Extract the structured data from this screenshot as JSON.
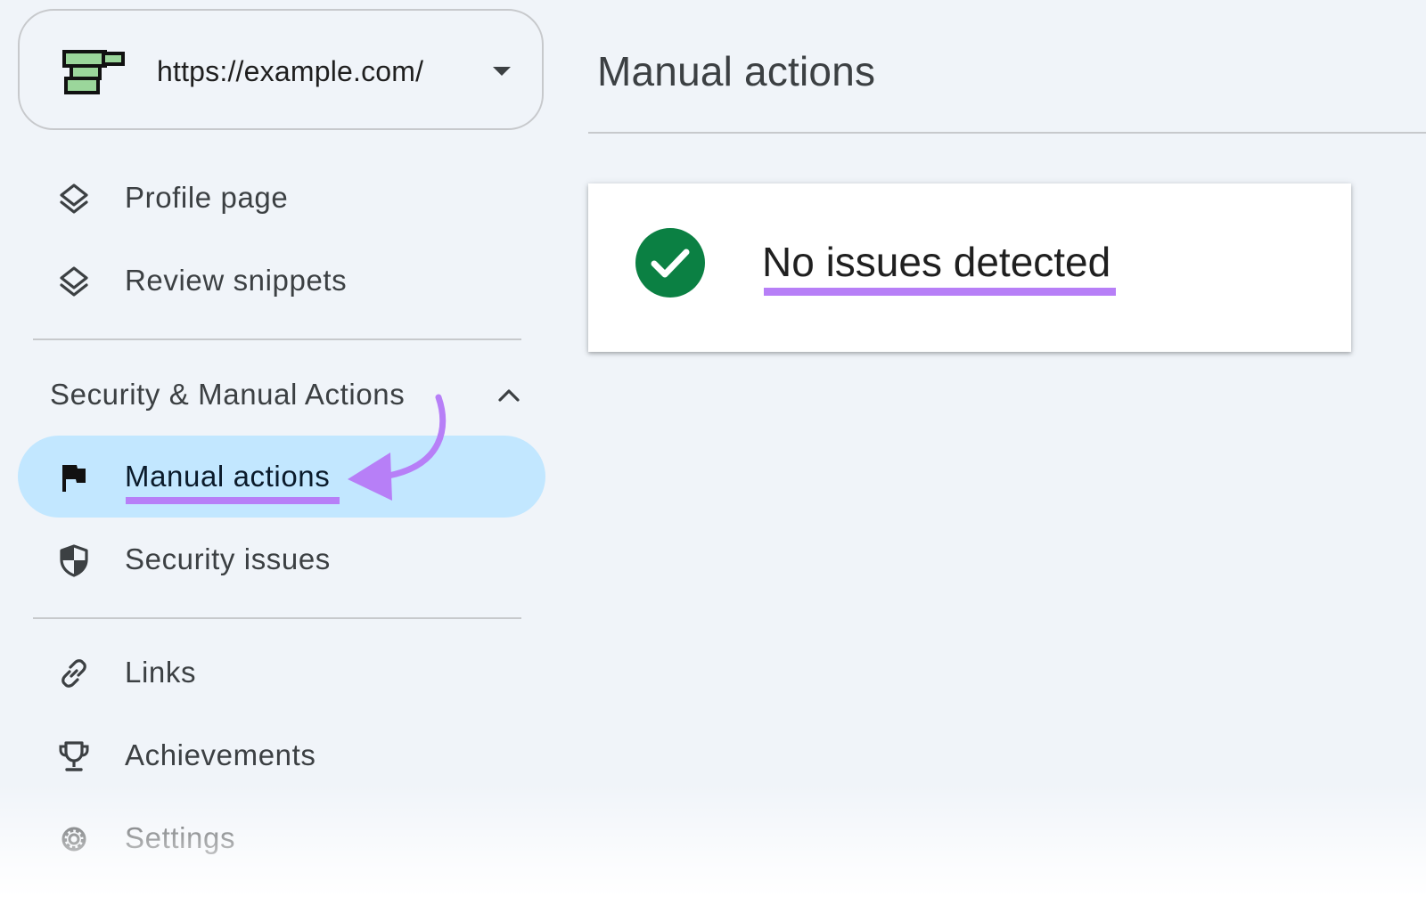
{
  "property": {
    "url": "https://example.com/",
    "logo_icon": "property-logo-icon",
    "dropdown_icon": "caret-down-icon"
  },
  "sidebar": {
    "items_top": [
      {
        "label": "Profile page",
        "icon": "layers-icon"
      },
      {
        "label": "Review snippets",
        "icon": "layers-icon"
      }
    ],
    "section": {
      "label": "Security & Manual Actions",
      "expanded": true,
      "icon": "chevron-up-icon",
      "items": [
        {
          "label": "Manual actions",
          "icon": "flag-icon",
          "active": true
        },
        {
          "label": "Security issues",
          "icon": "shield-icon"
        }
      ]
    },
    "items_bottom": [
      {
        "label": "Links",
        "icon": "link-icon"
      },
      {
        "label": "Achievements",
        "icon": "trophy-icon"
      },
      {
        "label": "Settings",
        "icon": "gear-icon"
      }
    ]
  },
  "main": {
    "title": "Manual actions",
    "status": {
      "message": "No issues detected",
      "icon": "check-circle-icon",
      "color": "#0b8043"
    }
  },
  "colors": {
    "background": "#f0f4f9",
    "active_item": "#c2e7ff",
    "annotation": "#b77ff7"
  },
  "annotation": {
    "arrow_icon": "curved-arrow-icon"
  }
}
